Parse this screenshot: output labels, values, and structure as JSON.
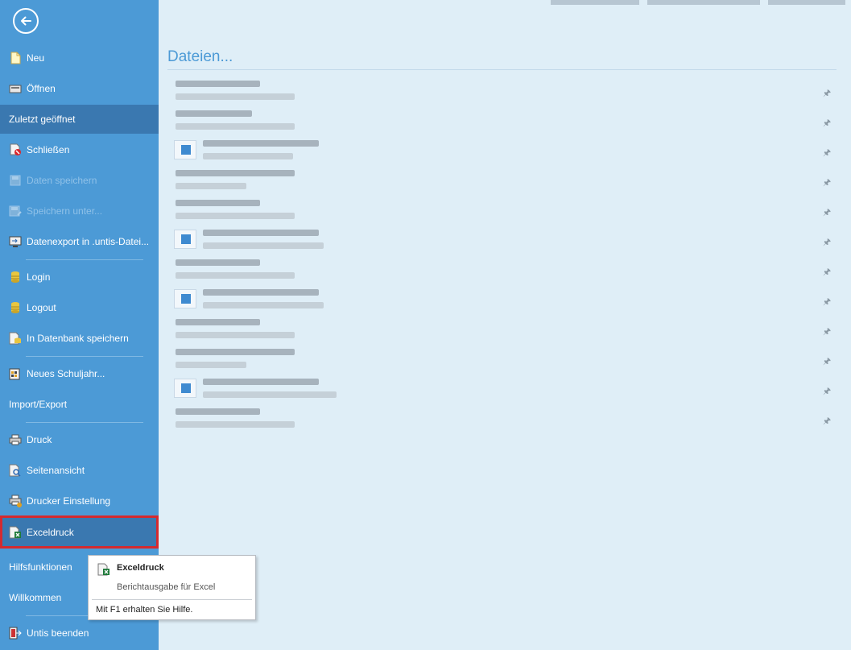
{
  "sidebar": {
    "back_label": "Zurück",
    "items": [
      {
        "label": "Neu",
        "icon": "new-document-icon",
        "state": "normal"
      },
      {
        "label": "Öffnen",
        "icon": "open-folder-icon",
        "state": "normal"
      },
      {
        "label": "Zuletzt geöffnet",
        "icon": "",
        "state": "active"
      },
      {
        "label": "Schließen",
        "icon": "close-document-icon",
        "state": "normal"
      },
      {
        "label": "Daten speichern",
        "icon": "save-disk-icon",
        "state": "disabled"
      },
      {
        "label": "Speichern unter...",
        "icon": "save-as-disk-icon",
        "state": "disabled"
      },
      {
        "label": "Datenexport in .untis-Datei...",
        "icon": "export-monitor-icon",
        "state": "normal"
      },
      {
        "label": "Login",
        "icon": "database-login-icon",
        "state": "normal"
      },
      {
        "label": "Logout",
        "icon": "database-logout-icon",
        "state": "normal"
      },
      {
        "label": "In Datenbank speichern",
        "icon": "database-save-icon",
        "state": "normal"
      },
      {
        "label": "Neues Schuljahr...",
        "icon": "new-school-year-icon",
        "state": "normal"
      },
      {
        "label": "Import/Export",
        "icon": "",
        "state": "normal"
      },
      {
        "label": "Druck",
        "icon": "printer-icon",
        "state": "normal"
      },
      {
        "label": "Seitenansicht",
        "icon": "print-preview-icon",
        "state": "normal"
      },
      {
        "label": "Drucker Einstellung",
        "icon": "printer-settings-icon",
        "state": "normal"
      },
      {
        "label": "Exceldruck",
        "icon": "excel-print-icon",
        "state": "highlight"
      },
      {
        "label": "Hilfsfunktionen",
        "icon": "",
        "state": "normal"
      },
      {
        "label": "Willkommen",
        "icon": "",
        "state": "normal"
      },
      {
        "label": "Untis beenden",
        "icon": "exit-app-icon",
        "state": "normal"
      }
    ]
  },
  "main": {
    "title": "Dateien..."
  },
  "tooltip": {
    "title": "Exceldruck",
    "description": "Berichtausgabe für Excel",
    "help": "Mit F1 erhalten Sie Hilfe."
  },
  "colors": {
    "sidebar_bg": "#4c9ad6",
    "active_bg": "#3a78b0",
    "highlight_border": "#d42a2f",
    "main_bg": "#dfeef7",
    "title_color": "#4c9ad6"
  }
}
